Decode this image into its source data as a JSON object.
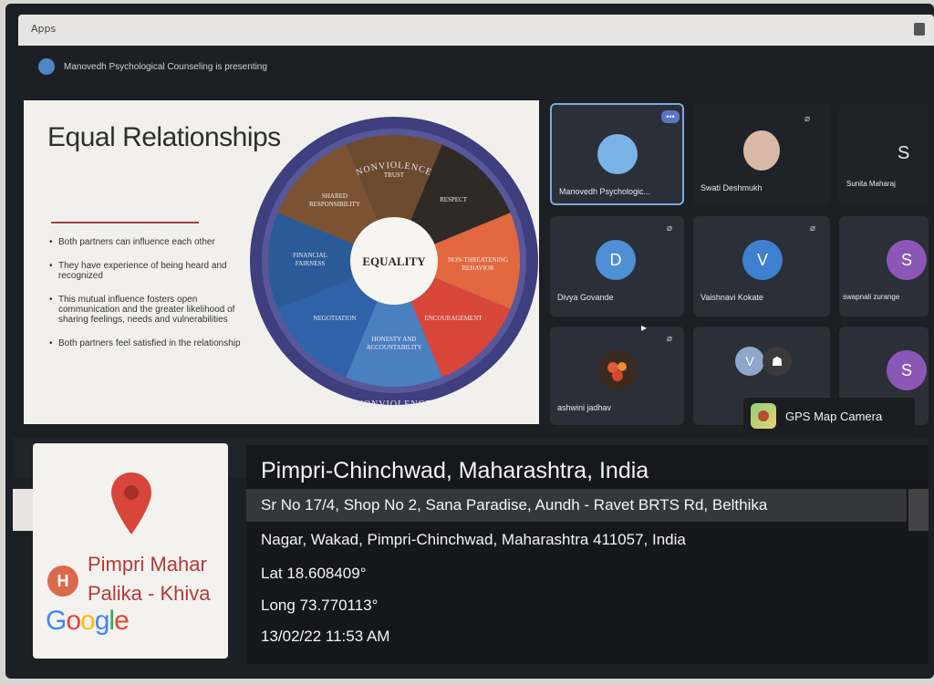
{
  "window": {
    "app_label": "Apps"
  },
  "presenting": {
    "text": "Manovedh Psychological Counseling is presenting"
  },
  "slide": {
    "title": "Equal Relationships",
    "bullets": [
      "Both partners can influence each other",
      "They have experience of being heard and recognized",
      "This mutual influence fosters open communication and the greater likelihood of sharing feelings, needs and vulnerabilities",
      "Both partners feel satisfied in the relationship"
    ],
    "wheel": {
      "center": "EQUALITY",
      "ring_top": "NONVIOLENCE",
      "ring_bottom": "NONVIOLENCE",
      "segments": [
        {
          "label": "TRUST",
          "color": "#6b4a2e"
        },
        {
          "label": "RESPECT",
          "color": "#2f2a26"
        },
        {
          "label": "NON-THREATENING BEHAVIOR",
          "color": "#e2673f"
        },
        {
          "label": "ENCOURAGEMENT",
          "color": "#d8473a"
        },
        {
          "label": "HONESTY AND ACCOUNTABILITY",
          "color": "#4a7fc0"
        },
        {
          "label": "NEGOTIATION",
          "color": "#2f62a8"
        },
        {
          "label": "FINANCIAL FAIRNESS",
          "color": "#2a5b98"
        },
        {
          "label": "SHARED RESPONSIBILITY",
          "color": "#7b5334"
        }
      ]
    }
  },
  "participants": [
    {
      "name": "Manovedh Psychologic...",
      "initial": "",
      "color": "#7bb3e8"
    },
    {
      "name": "Swati Deshmukh",
      "initial": "",
      "color": "#d9b9a6"
    },
    {
      "name": "Sunita Maharaj",
      "initial": "S",
      "color": ""
    },
    {
      "name": "Divya Govande",
      "initial": "D",
      "color": "#4f8fd6"
    },
    {
      "name": "Vaishnavi Kokate",
      "initial": "V",
      "color": "#3f7fd0"
    },
    {
      "name": "swapnali zurange",
      "initial": "S",
      "color": "#8a57b7"
    },
    {
      "name": "ashwini jadhav",
      "initial": "",
      "color": "#3a2a22"
    },
    {
      "name": "",
      "initial": "V",
      "color": "#8fa8c9"
    },
    {
      "name": "",
      "initial": "S",
      "color": "#8a57b7"
    }
  ],
  "gps_badge": {
    "label": "GPS Map Camera"
  },
  "map_card": {
    "place_line1": "Pimpri Mahar",
    "place_line2": "Palika - Khiva",
    "badge": "H",
    "brand": "Google"
  },
  "address": {
    "city": "Pimpri-Chinchwad, Maharashtra, India",
    "street_line1": "Sr No 17/4, Shop No 2, Sana Paradise, Aundh - Ravet BRTS Rd, Belthika",
    "street_line2": "Nagar, Wakad, Pimpri-Chinchwad, Maharashtra 411057, India",
    "lat": "Lat 18.608409°",
    "long": "Long 73.770113°",
    "timestamp": "13/02/22 11:53 AM"
  }
}
